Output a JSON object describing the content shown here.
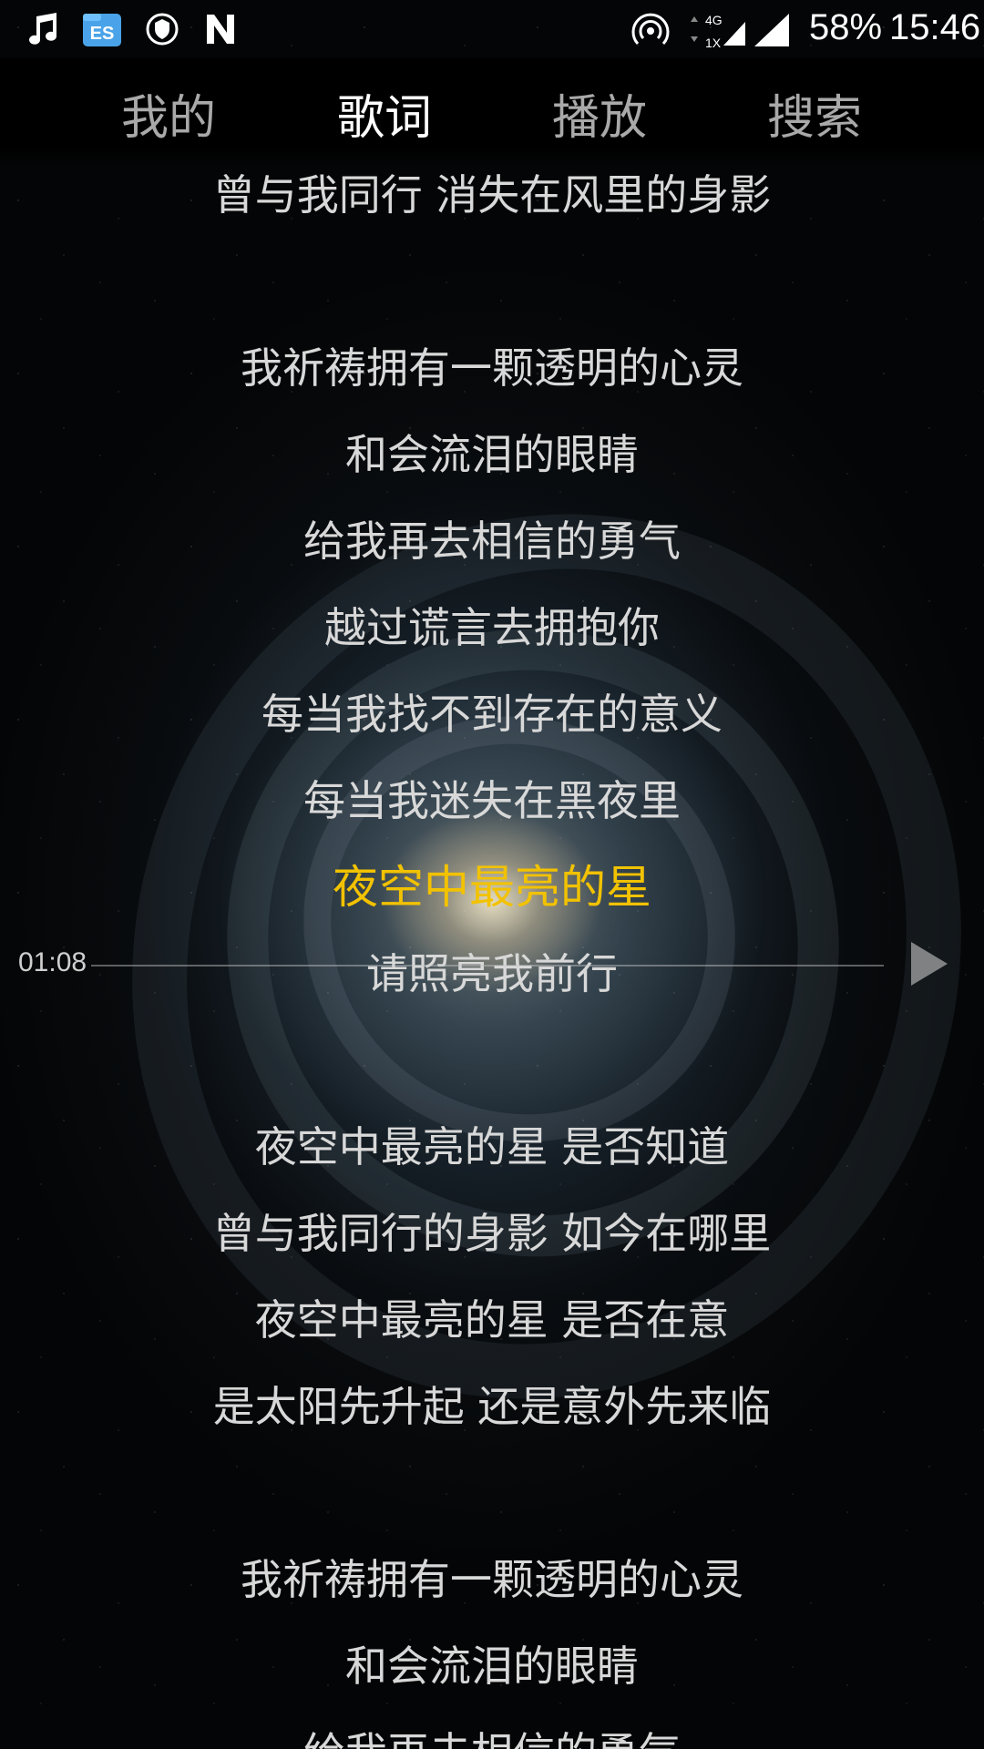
{
  "status_bar": {
    "battery": "58%",
    "time": "15:46",
    "network_top": "4G",
    "network_bottom": "1X",
    "icons": [
      "music-note-icon",
      "file-manager-icon",
      "shield-icon",
      "n-app-icon",
      "hotspot-icon",
      "mobile-signal-icon",
      "signal-icon"
    ]
  },
  "tabs": [
    {
      "label": "我的",
      "active": false
    },
    {
      "label": "歌词",
      "active": true
    },
    {
      "label": "播放",
      "active": false
    },
    {
      "label": "搜索",
      "active": false
    }
  ],
  "lyrics": {
    "lines": [
      "曾与我同行 消失在风里的身影",
      "",
      "我祈祷拥有一颗透明的心灵",
      "和会流泪的眼睛",
      "给我再去相信的勇气",
      "越过谎言去拥抱你",
      "每当我找不到存在的意义",
      "每当我迷失在黑夜里",
      "夜空中最亮的星",
      "请照亮我前行",
      "",
      "夜空中最亮的星 是否知道",
      "曾与我同行的身影 如今在哪里",
      "夜空中最亮的星 是否在意",
      "是太阳先升起 还是意外先来临",
      "",
      "我祈祷拥有一颗透明的心灵",
      "和会流泪的眼睛",
      "给我再去相信的勇气"
    ],
    "current_index": 8
  },
  "colors": {
    "current_line": "#f2c200",
    "line": "#d8d8d8",
    "tab_active": "#ffffff",
    "tab_inactive": "#a9a9a9"
  },
  "player": {
    "time": "01:08"
  }
}
